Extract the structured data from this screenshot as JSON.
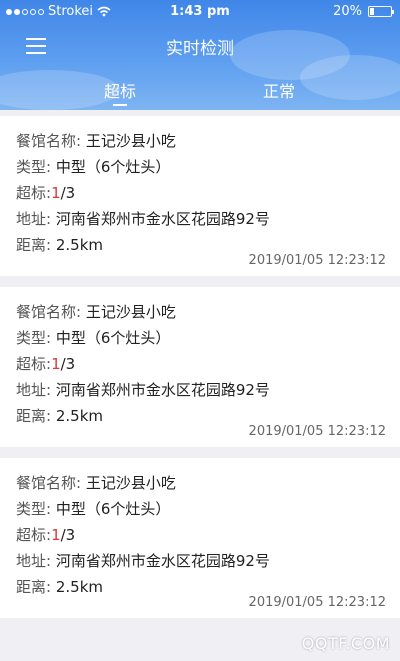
{
  "status_bar": {
    "carrier": "Strokei",
    "time": "1:43 pm",
    "battery": "20%",
    "battery_level": 0.2
  },
  "nav": {
    "title": "实时检测",
    "menu_icon": "hamburger-menu-icon"
  },
  "tabs": [
    {
      "label": "超标",
      "active": true
    },
    {
      "label": "正常",
      "active": false
    }
  ],
  "labels": {
    "name": "餐馆名称:",
    "type": "类型:",
    "exceed": "超标:",
    "address": "地址:",
    "distance": "距离:"
  },
  "records": [
    {
      "name": "王记沙县小吃",
      "type": "中型（6个灶头）",
      "exceed_count": "1",
      "exceed_total": "/3",
      "address": "河南省郑州市金水区花园路92号",
      "distance": "2.5km",
      "time": "2019/01/05 12:23:12"
    },
    {
      "name": "王记沙县小吃",
      "type": "中型（6个灶头）",
      "exceed_count": "1",
      "exceed_total": "/3",
      "address": "河南省郑州市金水区花园路92号",
      "distance": "2.5km",
      "time": "2019/01/05 12:23:12"
    },
    {
      "name": "王记沙县小吃",
      "type": "中型（6个灶头）",
      "exceed_count": "1",
      "exceed_total": "/3",
      "address": "河南省郑州市金水区花园路92号",
      "distance": "2.5km",
      "time": "2019/01/05 12:23:12"
    }
  ],
  "watermark": "QQTF.COM",
  "colors": {
    "header": "#4a8eea",
    "exceed": "#d83b3b",
    "background": "#efeff4"
  }
}
